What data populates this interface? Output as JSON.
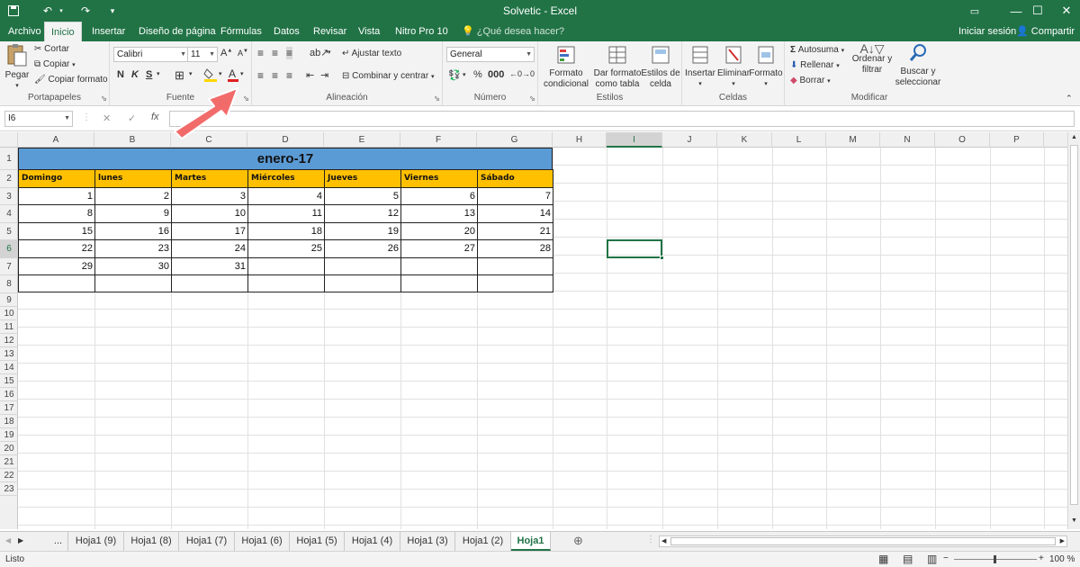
{
  "window": {
    "title": "Solvetic - Excel"
  },
  "ribbon_tabs": [
    "Archivo",
    "Inicio",
    "Insertar",
    "Diseño de página",
    "Fórmulas",
    "Datos",
    "Revisar",
    "Vista",
    "Nitro Pro 10"
  ],
  "tell_me": "¿Qué desea hacer?",
  "account": {
    "signin": "Iniciar sesión",
    "share": "Compartir"
  },
  "clipboard": {
    "paste": "Pegar",
    "cut": "Cortar",
    "copy": "Copiar",
    "format_painter": "Copiar formato",
    "label": "Portapapeles"
  },
  "font": {
    "name": "Calibri",
    "size": "11",
    "bold": "N",
    "italic": "K",
    "underline": "S",
    "label": "Fuente"
  },
  "alignment": {
    "wrap": "Ajustar texto",
    "merge": "Combinar y centrar",
    "label": "Alineación"
  },
  "number": {
    "format": "General",
    "label": "Número"
  },
  "styles": {
    "cond": "Formato condicional",
    "table": "Dar formato como tabla",
    "cell": "Estilos de celda",
    "label": "Estilos"
  },
  "cells": {
    "insert": "Insertar",
    "delete": "Eliminar",
    "format": "Formato",
    "label": "Celdas"
  },
  "editing": {
    "autosum": "Autosuma",
    "fill": "Rellenar",
    "clear": "Borrar",
    "sort": "Ordenar y filtrar",
    "find": "Buscar y seleccionar",
    "label": "Modificar"
  },
  "formula_bar": {
    "namebox": "I6",
    "fx": "fx",
    "content": ""
  },
  "columns": [
    "A",
    "B",
    "C",
    "D",
    "E",
    "F",
    "G",
    "H",
    "I",
    "J",
    "K",
    "L",
    "M",
    "N",
    "O",
    "P"
  ],
  "rows": [
    "1",
    "2",
    "3",
    "4",
    "5",
    "6",
    "7",
    "8",
    "9",
    "10",
    "11",
    "12",
    "13",
    "14",
    "15",
    "16",
    "17",
    "18",
    "19",
    "20",
    "21",
    "22",
    "23"
  ],
  "calendar": {
    "title": "enero-17",
    "days": [
      "Domingo",
      "lunes",
      "Martes",
      "Miércoles",
      "Jueves",
      "Viernes",
      "Sábado"
    ],
    "weeks": [
      [
        "1",
        "2",
        "3",
        "4",
        "5",
        "6",
        "7"
      ],
      [
        "8",
        "9",
        "10",
        "11",
        "12",
        "13",
        "14"
      ],
      [
        "15",
        "16",
        "17",
        "18",
        "19",
        "20",
        "21"
      ],
      [
        "22",
        "23",
        "24",
        "25",
        "26",
        "27",
        "28"
      ],
      [
        "29",
        "30",
        "31",
        "",
        "",
        "",
        ""
      ],
      [
        "",
        "",
        "",
        "",
        "",
        "",
        ""
      ]
    ]
  },
  "sheets": {
    "ellipsis": "...",
    "tabs": [
      "Hoja1 (9)",
      "Hoja1 (8)",
      "Hoja1 (7)",
      "Hoja1 (6)",
      "Hoja1 (5)",
      "Hoja1 (4)",
      "Hoja1 (3)",
      "Hoja1 (2)",
      "Hoja1"
    ],
    "active": "Hoja1"
  },
  "status": {
    "ready": "Listo",
    "zoom": "100 %"
  },
  "colors": {
    "brand": "#217346",
    "title_fill": "#5b9bd5",
    "header_fill": "#ffc000",
    "arrow": "#f26b6b"
  }
}
